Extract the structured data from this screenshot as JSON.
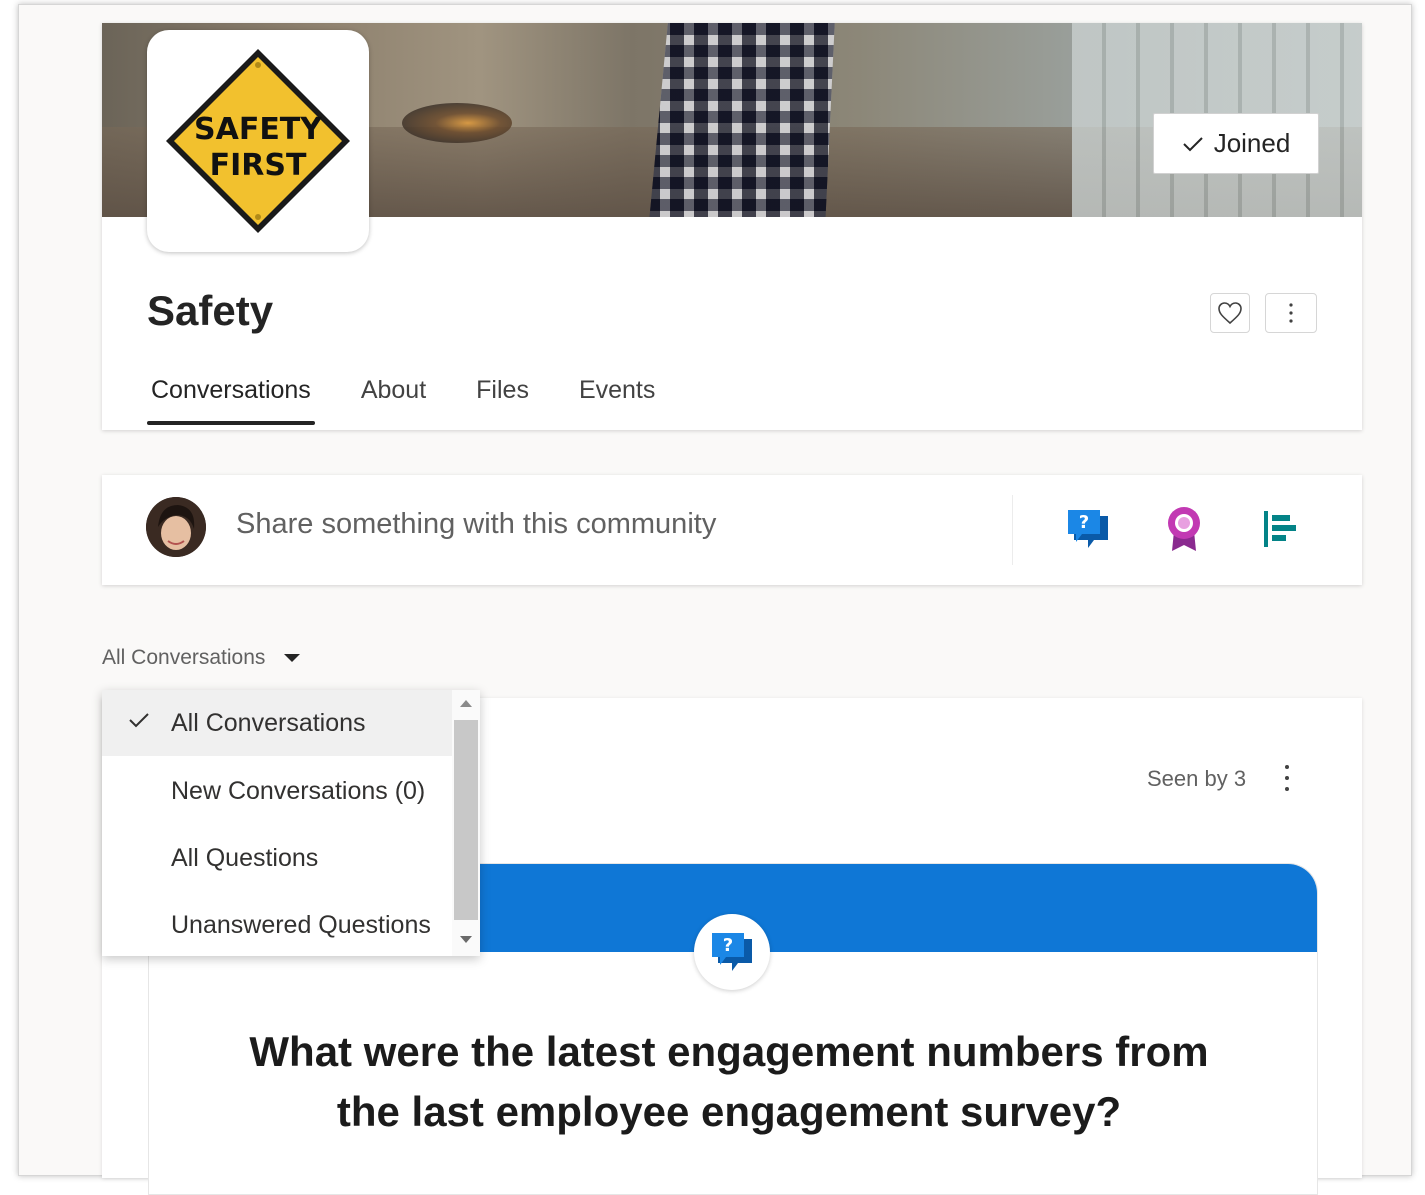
{
  "community": {
    "name": "Safety",
    "logo_text_line1": "SAFETY",
    "logo_text_line2": "FIRST",
    "joined_label": "Joined"
  },
  "tabs": [
    {
      "label": "Conversations",
      "active": true
    },
    {
      "label": "About",
      "active": false
    },
    {
      "label": "Files",
      "active": false
    },
    {
      "label": "Events",
      "active": false
    }
  ],
  "composer": {
    "placeholder": "Share something with this community",
    "actions": [
      "question-icon",
      "praise-icon",
      "poll-icon"
    ]
  },
  "filter": {
    "selected": "All Conversations",
    "options": [
      {
        "label": "All Conversations",
        "selected": true
      },
      {
        "label": "New Conversations (0)",
        "selected": false
      },
      {
        "label": "All Questions",
        "selected": false
      },
      {
        "label": "Unanswered Questions",
        "selected": false
      }
    ]
  },
  "post": {
    "seen_by": "Seen by 3",
    "question_title": "What were the latest engagement numbers from the last employee engagement survey?"
  },
  "colors": {
    "accent_blue": "#0f77d6",
    "logo_yellow": "#f2c12e",
    "praise_magenta": "#c239b3",
    "poll_teal": "#038387"
  }
}
